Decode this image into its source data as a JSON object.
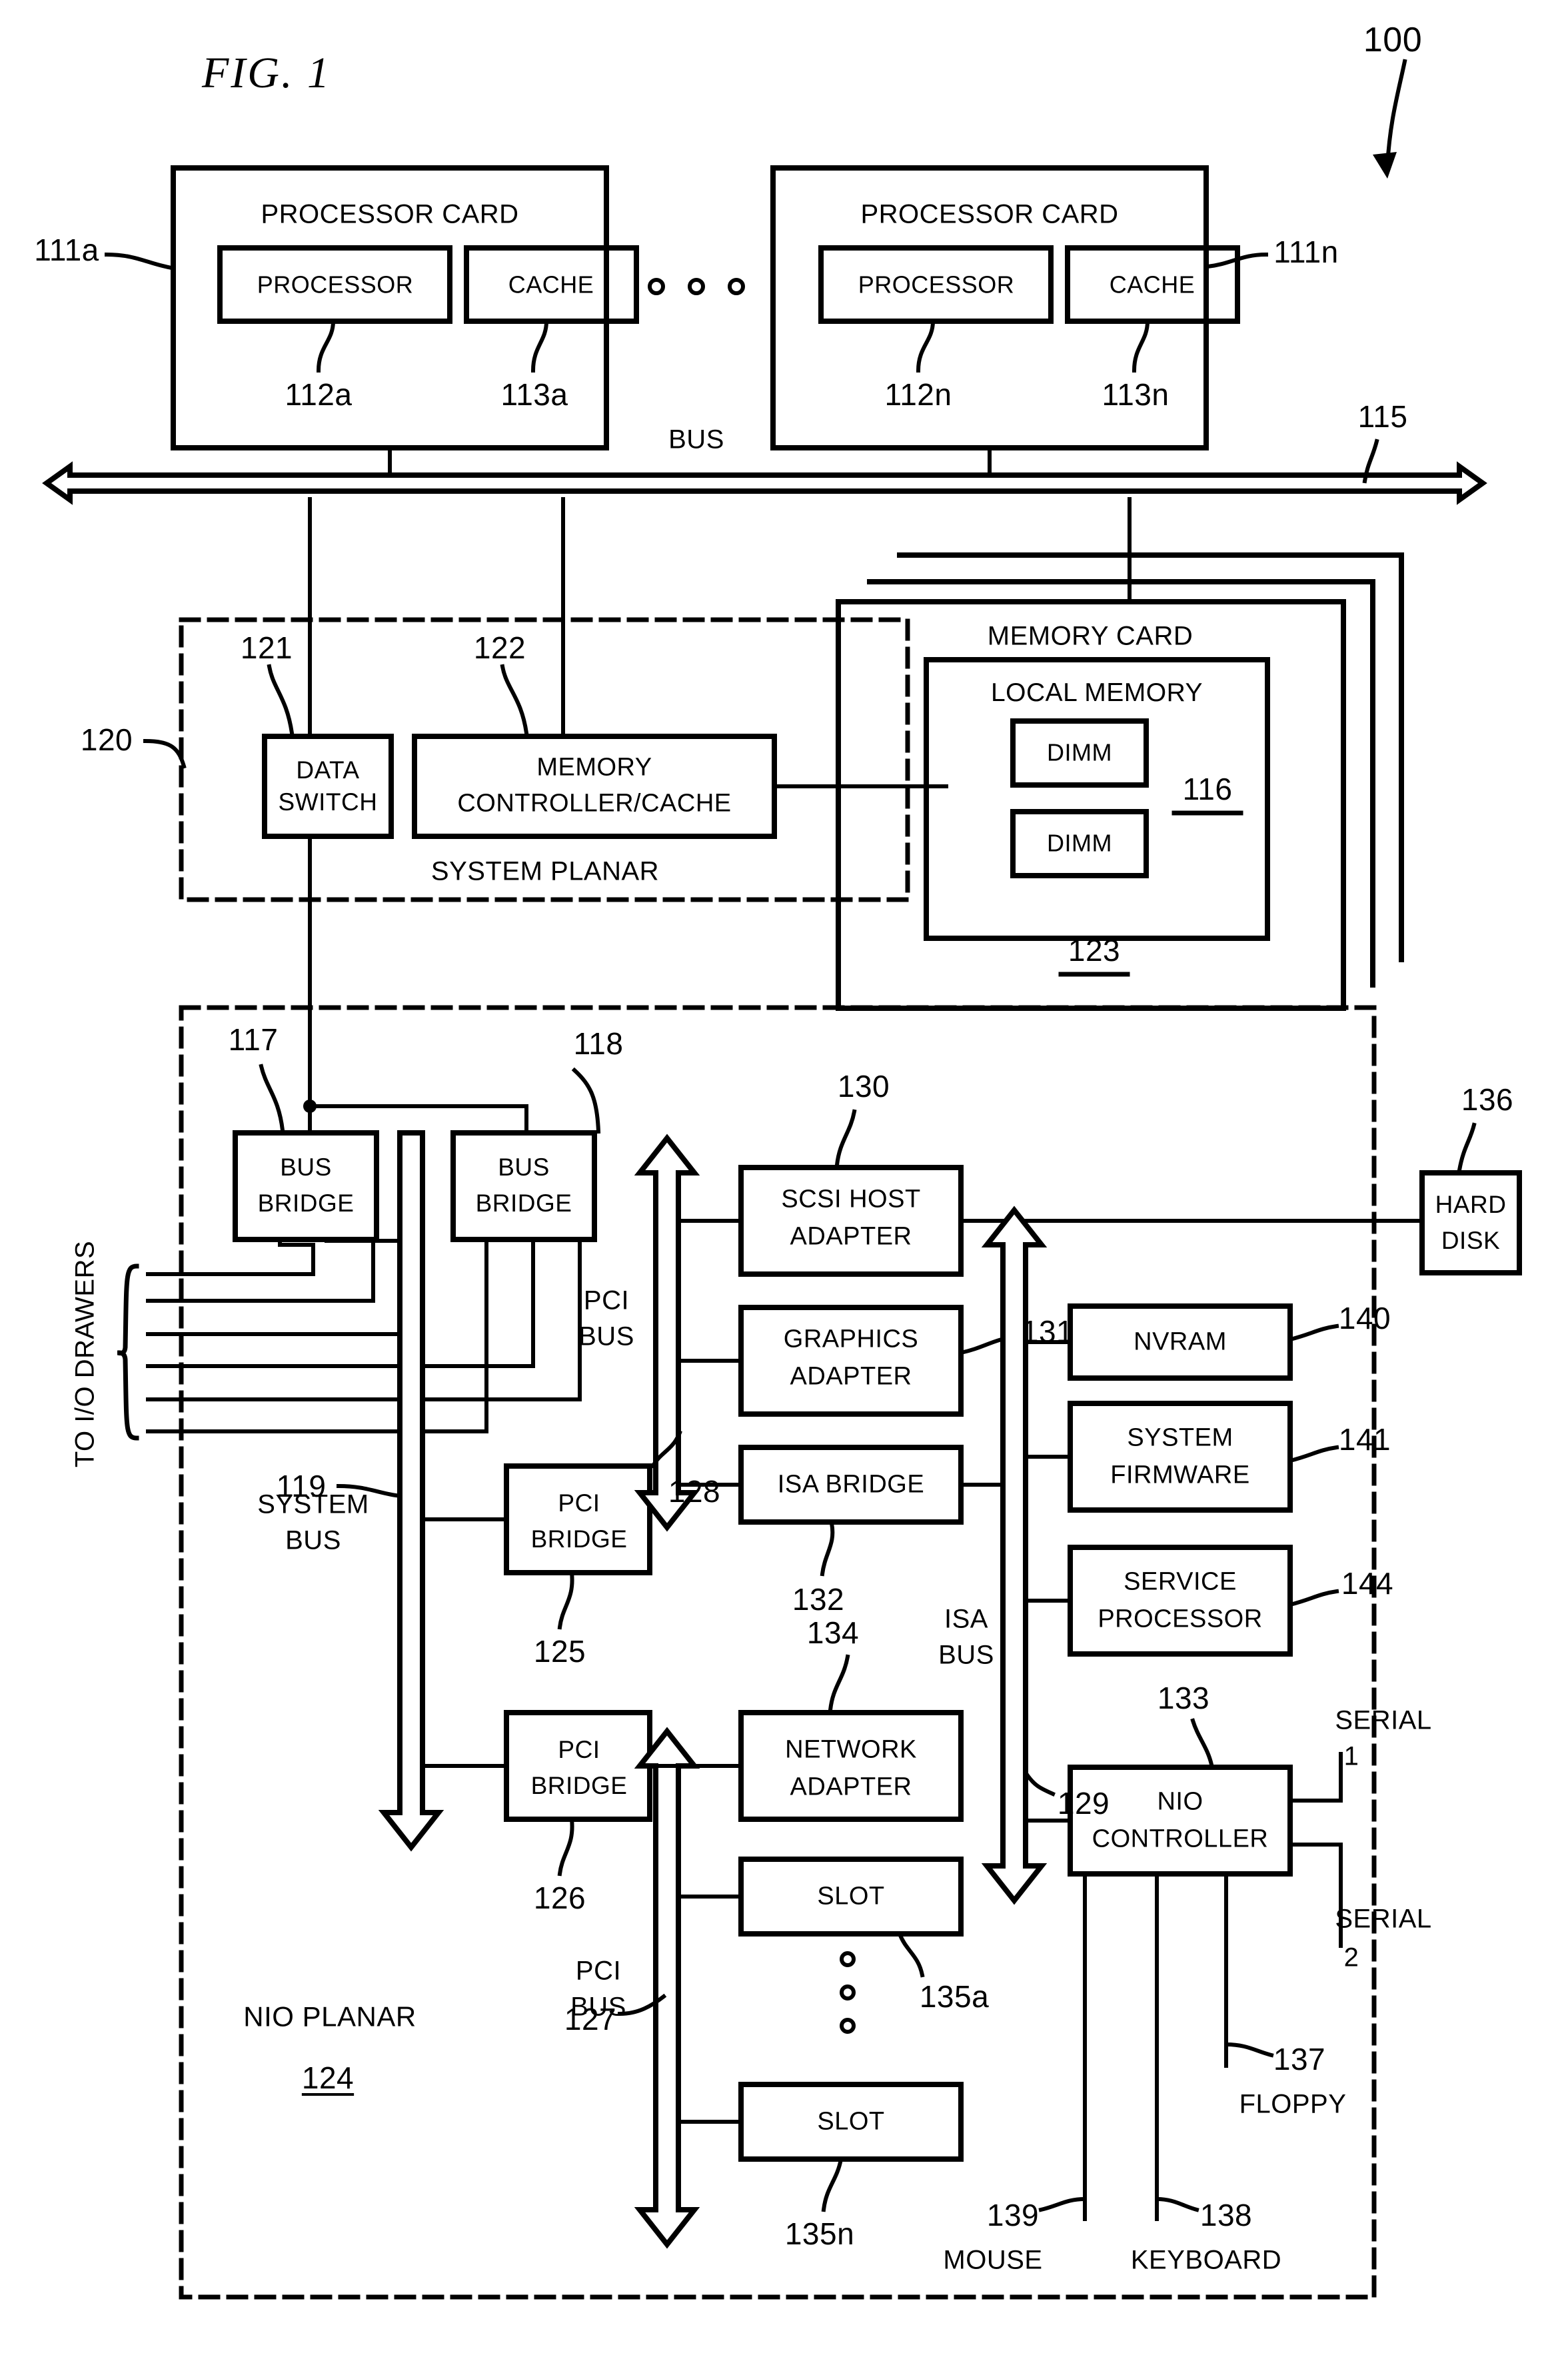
{
  "figure": {
    "title": "FIG.  1",
    "system_ref": "100"
  },
  "processor_cards": [
    {
      "title": "PROCESSOR CARD",
      "ref": "111a",
      "processor": {
        "label": "PROCESSOR",
        "ref": "112a"
      },
      "cache": {
        "label": "CACHE",
        "ref": "113a"
      }
    },
    {
      "title": "PROCESSOR CARD",
      "ref": "111n",
      "processor": {
        "label": "PROCESSOR",
        "ref": "112n"
      },
      "cache": {
        "label": "CACHE",
        "ref": "113n"
      }
    }
  ],
  "ellipsis_between_cards": "o  o  o",
  "bus": {
    "label": "BUS",
    "ref": "115"
  },
  "system_planar": {
    "label": "SYSTEM PLANAR",
    "ref": "120",
    "data_switch": {
      "label": "DATA\nSWITCH",
      "line1": "DATA",
      "line2": "SWITCH",
      "ref": "121"
    },
    "memory_controller": {
      "line1": "MEMORY",
      "line2": "CONTROLLER/CACHE",
      "ref": "122"
    }
  },
  "memory_card": {
    "title": "MEMORY CARD",
    "ref": "123",
    "local_memory": {
      "title": "LOCAL MEMORY",
      "ref": "116"
    },
    "dimms": [
      "DIMM",
      "DIMM"
    ]
  },
  "nio_planar": {
    "label": "NIO PLANAR",
    "ref": "124",
    "io_drawers_label": "TO I/O DRAWERS",
    "system_bus": {
      "line1": "SYSTEM",
      "line2": "BUS",
      "ref": "119"
    },
    "bus_bridges": [
      {
        "line1": "BUS",
        "line2": "BRIDGE",
        "ref": "117"
      },
      {
        "line1": "BUS",
        "line2": "BRIDGE",
        "ref": "118"
      }
    ],
    "pci_bridges": [
      {
        "line1": "PCI",
        "line2": "BRIDGE",
        "ref": "125"
      },
      {
        "line1": "PCI",
        "line2": "BRIDGE",
        "ref": "126"
      }
    ],
    "pci_bus_top": {
      "line1": "PCI",
      "line2": "BUS",
      "ref": "128"
    },
    "pci_bus_bottom": {
      "line1": "PCI",
      "line2": "BUS",
      "ref": "127"
    },
    "isa_bus": {
      "line1": "ISA",
      "line2": "BUS",
      "ref": "129"
    },
    "devices": [
      {
        "line1": "SCSI HOST",
        "line2": "ADAPTER",
        "ref": "130"
      },
      {
        "line1": "GRAPHICS",
        "line2": "ADAPTER",
        "ref": "131"
      },
      {
        "line1": "ISA BRIDGE",
        "line2": "",
        "ref": "132"
      },
      {
        "line1": "NETWORK",
        "line2": "ADAPTER",
        "ref": "134"
      },
      {
        "line1": "SLOT",
        "line2": "",
        "ref": "135a"
      },
      {
        "line1": "SLOT",
        "line2": "",
        "ref": "135n"
      }
    ],
    "slot_ellipsis": "o o o",
    "isa_devices": [
      {
        "line1": "NVRAM",
        "line2": "",
        "ref": "140"
      },
      {
        "line1": "SYSTEM",
        "line2": "FIRMWARE",
        "ref": "141"
      },
      {
        "line1": "SERVICE",
        "line2": "PROCESSOR",
        "ref": "144"
      },
      {
        "line1": "NIO",
        "line2": "CONTROLLER",
        "ref": "133"
      }
    ],
    "nio_ports": {
      "serial1": {
        "line1": "SERIAL",
        "line2": "1"
      },
      "serial2": {
        "line1": "SERIAL",
        "line2": "2"
      },
      "floppy": {
        "label": "FLOPPY",
        "ref": "137"
      },
      "keyboard": {
        "label": "KEYBOARD",
        "ref": "138"
      },
      "mouse": {
        "label": "MOUSE",
        "ref": "139"
      }
    }
  },
  "hard_disk": {
    "line1": "HARD",
    "line2": "DISK",
    "ref": "136"
  },
  "colors": {
    "ink": "#000000",
    "paper": "#ffffff"
  }
}
